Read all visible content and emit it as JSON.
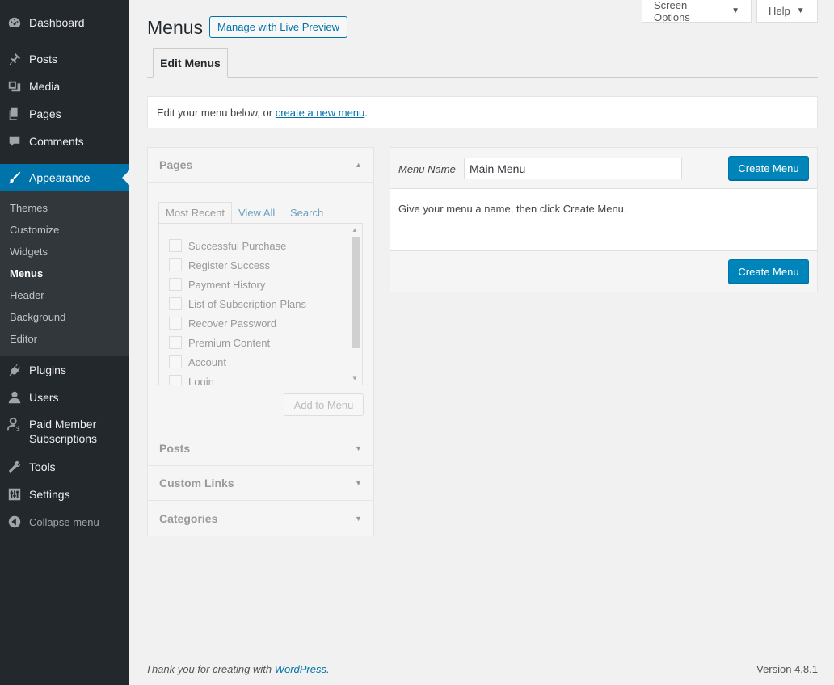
{
  "sidebar": {
    "items": [
      {
        "label": "Dashboard",
        "icon": "dashboard-icon"
      },
      {
        "label": "Posts",
        "icon": "pin-icon"
      },
      {
        "label": "Media",
        "icon": "media-icon"
      },
      {
        "label": "Pages",
        "icon": "pages-icon"
      },
      {
        "label": "Comments",
        "icon": "comment-icon"
      },
      {
        "label": "Appearance",
        "icon": "brush-icon"
      },
      {
        "label": "Plugins",
        "icon": "plugin-icon"
      },
      {
        "label": "Users",
        "icon": "user-icon"
      },
      {
        "label": "Paid Member Subscriptions",
        "icon": "member-icon"
      },
      {
        "label": "Tools",
        "icon": "wrench-icon"
      },
      {
        "label": "Settings",
        "icon": "settings-icon"
      },
      {
        "label": "Collapse menu",
        "icon": "collapse-icon"
      }
    ],
    "submenu": [
      "Themes",
      "Customize",
      "Widgets",
      "Menus",
      "Header",
      "Background",
      "Editor"
    ]
  },
  "header": {
    "title": "Menus",
    "live_preview": "Manage with Live Preview",
    "screen_options": "Screen Options",
    "help": "Help"
  },
  "tabs": {
    "edit_menus": "Edit Menus"
  },
  "notice": {
    "text_before": "Edit your menu below, or ",
    "link": "create a new menu",
    "text_after": "."
  },
  "accordion": {
    "pages_title": "Pages",
    "tabs": [
      "Most Recent",
      "View All",
      "Search"
    ],
    "pages": [
      "Successful Purchase",
      "Register Success",
      "Payment History",
      "List of Subscription Plans",
      "Recover Password",
      "Premium Content",
      "Account",
      "Login"
    ],
    "add_to_menu": "Add to Menu",
    "sections": [
      "Posts",
      "Custom Links",
      "Categories"
    ]
  },
  "menu_panel": {
    "name_label": "Menu Name",
    "name_value": "Main Menu",
    "create_button": "Create Menu",
    "instructions": "Give your menu a name, then click Create Menu."
  },
  "footer": {
    "thanks_before": "Thank you for creating with ",
    "thanks_link": "WordPress",
    "thanks_after": ".",
    "version": "Version 4.8.1"
  },
  "colors": {
    "accent": "#0073aa",
    "primary_button": "#0085ba",
    "sidebar_bg": "#23282d",
    "submenu_bg": "#32373c"
  }
}
